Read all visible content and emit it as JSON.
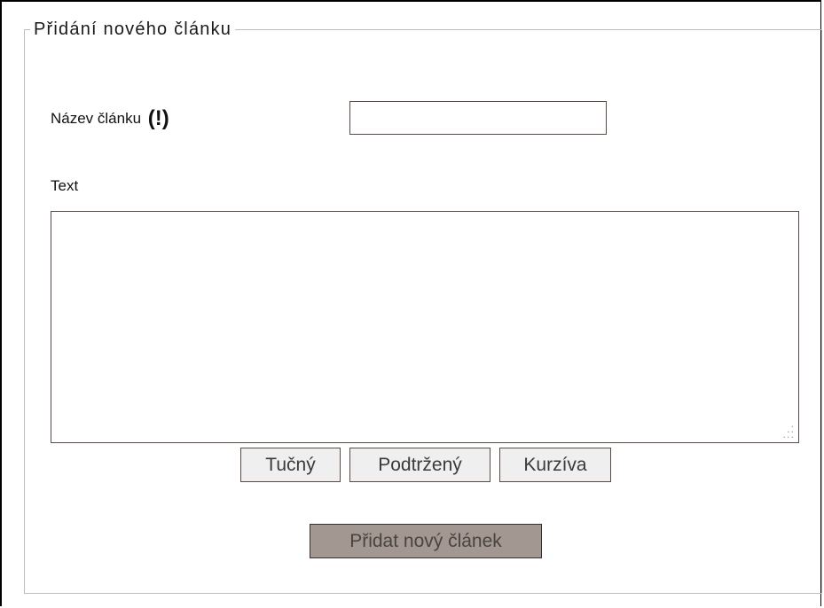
{
  "form": {
    "legend": "Přidání nového článku",
    "title_label": "Název článku",
    "required_mark": "(!)",
    "title_value": "",
    "text_label": "Text",
    "text_value": ""
  },
  "formatting": {
    "bold_label": "Tučný",
    "underline_label": "Podtržený",
    "italic_label": "Kurzíva"
  },
  "actions": {
    "submit_label": "Přidat nový článek"
  },
  "icons": {
    "resize_grip": "resize-grip-icon"
  },
  "colors": {
    "input_border": "#5a4a44",
    "fieldset_border": "#bdbdbd",
    "format_button_bg": "#efefef",
    "submit_button_bg": "#a39891"
  }
}
